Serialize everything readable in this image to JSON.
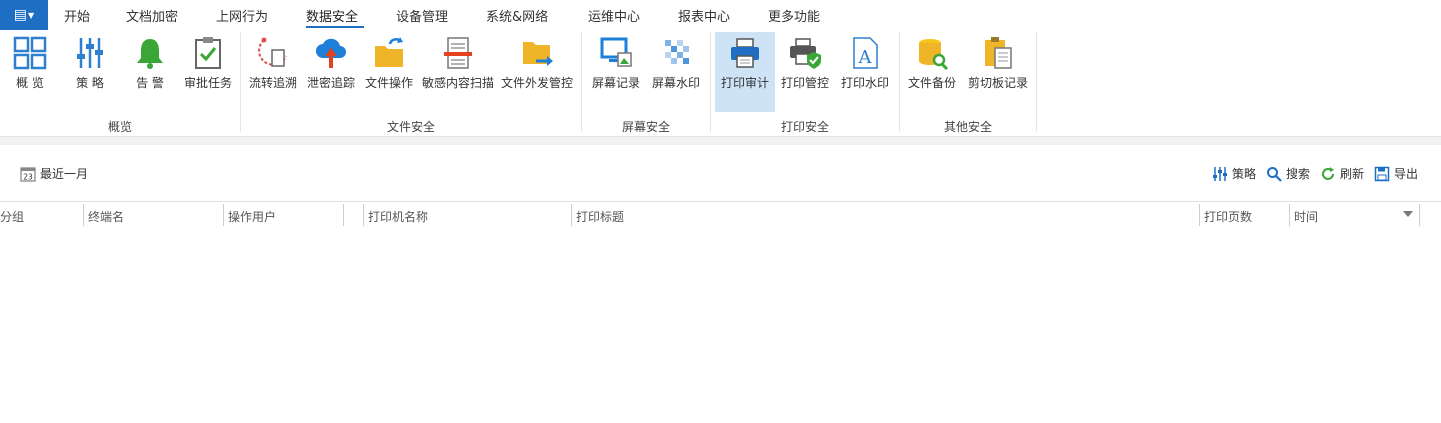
{
  "menu": {
    "app_icon": "list-icon",
    "items": [
      "开始",
      "文档加密",
      "上网行为",
      "数据安全",
      "设备管理",
      "系统&网络",
      "运维中心",
      "报表中心",
      "更多功能"
    ],
    "active": "数据安全"
  },
  "ribbon": {
    "buttons": [
      {
        "label": "概 览",
        "icon": "grid-icon"
      },
      {
        "label": "策 略",
        "icon": "sliders-icon"
      },
      {
        "label": "告 警",
        "icon": "bell-icon"
      },
      {
        "label": "审批任务",
        "icon": "clipboard-check-icon"
      },
      {
        "label": "流转追溯",
        "icon": "document-trace-icon"
      },
      {
        "label": "泄密追踪",
        "icon": "cloud-upload-icon"
      },
      {
        "label": "文件操作",
        "icon": "folder-arrow-icon"
      },
      {
        "label": "敏感内容扫描",
        "icon": "document-scan-icon"
      },
      {
        "label": "文件外发管控",
        "icon": "folder-send-icon"
      },
      {
        "label": "屏幕记录",
        "icon": "monitor-image-icon"
      },
      {
        "label": "屏幕水印",
        "icon": "mosaic-icon"
      },
      {
        "label": "打印审计",
        "icon": "printer-icon"
      },
      {
        "label": "打印管控",
        "icon": "printer-shield-icon"
      },
      {
        "label": "打印水印",
        "icon": "document-a-icon"
      },
      {
        "label": "文件备份",
        "icon": "database-search-icon"
      },
      {
        "label": "剪切板记录",
        "icon": "clipboard-copy-icon"
      }
    ],
    "selected": "打印审计",
    "groups": [
      "概览",
      "文件安全",
      "屏幕安全",
      "打印安全",
      "其他安全"
    ]
  },
  "toolbar": {
    "date_range": "最近一月",
    "date_icon_text": "23",
    "actions": [
      {
        "label": "策略",
        "icon": "sliders-icon"
      },
      {
        "label": "搜索",
        "icon": "search-icon"
      },
      {
        "label": "刷新",
        "icon": "refresh-icon"
      },
      {
        "label": "导出",
        "icon": "save-icon"
      }
    ]
  },
  "table": {
    "columns": [
      "分组",
      "终端名",
      "操作用户",
      "打印机名称",
      "打印标题",
      "打印页数",
      "时间"
    ],
    "rows": []
  },
  "colors": {
    "accent": "#1e6fc4",
    "selected_bg": "#cfe3f6"
  }
}
